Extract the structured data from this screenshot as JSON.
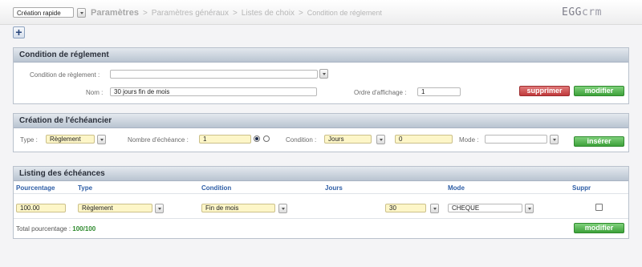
{
  "topbar": {
    "quick_select": "Création rapide",
    "breadcrumb": [
      "Paramètres",
      "Paramètres généraux",
      "Listes de choix",
      "Condition de réglement"
    ],
    "logo_main": "EGG",
    "logo_suffix": "crm"
  },
  "toolbar": {
    "add_icon": "+"
  },
  "condition_panel": {
    "title": "Condition de réglement",
    "condition_label": "Condition de règlement :",
    "condition_value": "",
    "nom_label": "Nom :",
    "nom_value": "30 jours fin de mois",
    "ordre_label": "Ordre d'affichage :",
    "ordre_value": "1",
    "delete_label": "supprimer",
    "modify_label": "modifier"
  },
  "echeancier_panel": {
    "title": "Création de l'échéancier",
    "type_label": "Type :",
    "type_value": "Règlement",
    "nombre_label": "Nombre d'échéance :",
    "nombre_value": "1",
    "radio_selected": 0,
    "condition_label": "Condition :",
    "condition_value": "Jours",
    "condition_number": "0",
    "mode_label": "Mode :",
    "mode_value": "",
    "insert_label": "insérer"
  },
  "listing_panel": {
    "title": "Listing des échéances",
    "columns": [
      "Pourcentage",
      "Type",
      "Condition",
      "Jours",
      "Mode",
      "Suppr"
    ],
    "rows": [
      {
        "pourcentage": "100.00",
        "type": "Règlement",
        "condition": "Fin de mois",
        "jours": "30",
        "mode": "CHEQUE",
        "suppr": false
      }
    ],
    "total_label": "Total pourcentage :",
    "total_value": "100/100",
    "modify_label": "modifier"
  },
  "colors": {
    "accent_blue": "#2e5ea6",
    "green": "#3da13a",
    "red": "#c0393b",
    "highlight_yellow": "#fdf6c8"
  }
}
